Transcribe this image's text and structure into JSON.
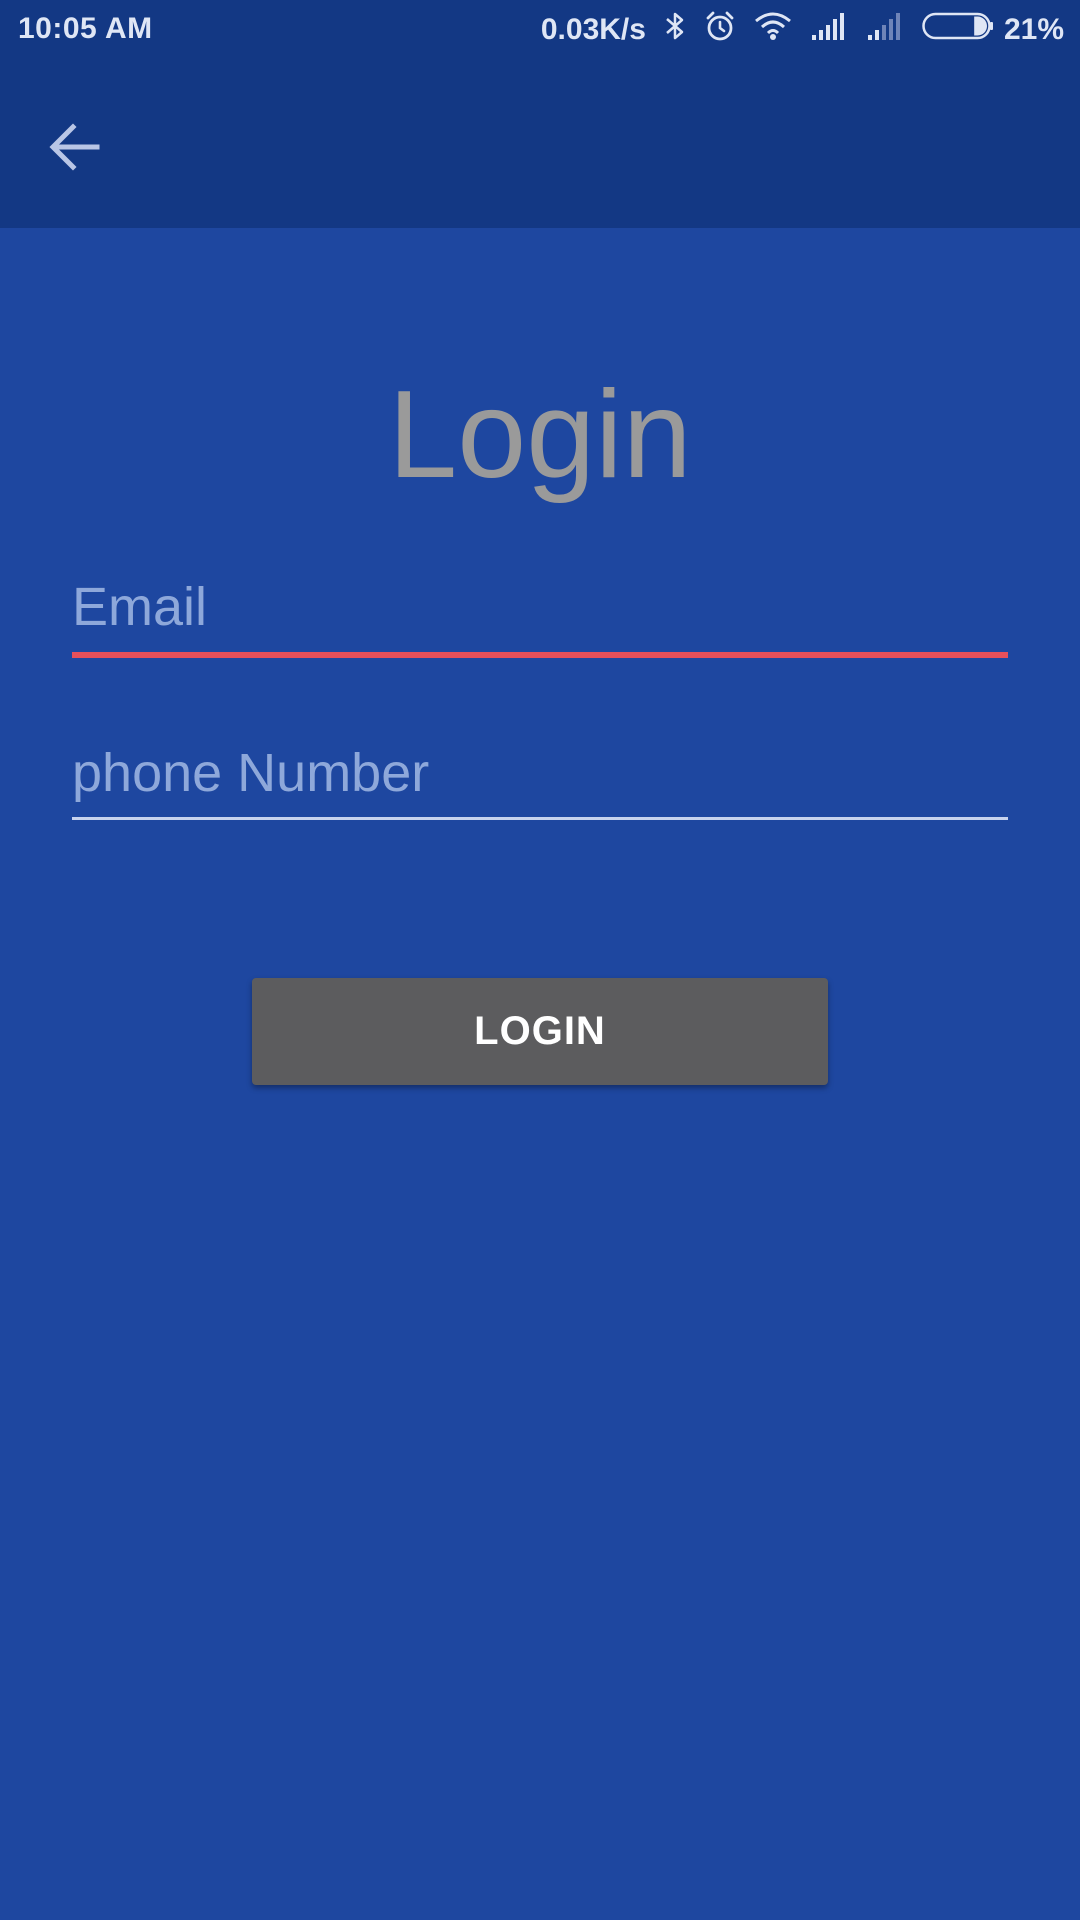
{
  "status_bar": {
    "time": "10:05 AM",
    "network_speed": "0.03K/s",
    "battery_percent": "21%",
    "battery_level": 0.21,
    "icons": [
      "bluetooth-icon",
      "alarm-icon",
      "wifi-icon",
      "signal-icon",
      "signal-weak-icon",
      "battery-icon"
    ]
  },
  "app_bar": {
    "back_icon": "arrow-back-icon"
  },
  "login_form": {
    "title": "Login",
    "email": {
      "value": "",
      "placeholder": "Email"
    },
    "phone": {
      "value": "",
      "placeholder": "phone Number"
    },
    "submit_label": "LOGIN"
  },
  "colors": {
    "background": "#1e47a0",
    "app_bar": "#133884",
    "title": "#9a9a9a",
    "email_underline_error": "#e6505a",
    "phone_underline": "#c7d3ee",
    "button": "#5c5c5e",
    "button_text": "#ffffff"
  }
}
